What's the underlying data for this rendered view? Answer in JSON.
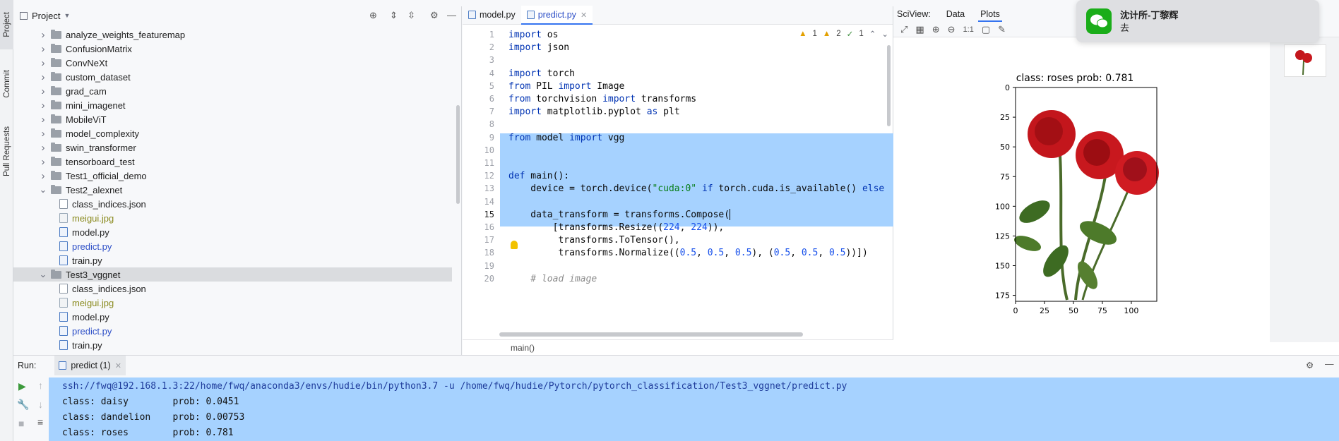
{
  "left_strip": {
    "tabs": [
      "Project",
      "Commit",
      "Pull Requests"
    ]
  },
  "project": {
    "title": "Project",
    "tree": [
      {
        "name": "analyze_weights_featuremap",
        "type": "folder",
        "state": "collapsed",
        "depth": 1,
        "color": "default"
      },
      {
        "name": "ConfusionMatrix",
        "type": "folder",
        "state": "collapsed",
        "depth": 1,
        "color": "default"
      },
      {
        "name": "ConvNeXt",
        "type": "folder",
        "state": "collapsed",
        "depth": 1,
        "color": "default"
      },
      {
        "name": "custom_dataset",
        "type": "folder",
        "state": "collapsed",
        "depth": 1,
        "color": "default"
      },
      {
        "name": "grad_cam",
        "type": "folder",
        "state": "collapsed",
        "depth": 1,
        "color": "default"
      },
      {
        "name": "mini_imagenet",
        "type": "folder",
        "state": "collapsed",
        "depth": 1,
        "color": "default"
      },
      {
        "name": "MobileViT",
        "type": "folder",
        "state": "collapsed",
        "depth": 1,
        "color": "default"
      },
      {
        "name": "model_complexity",
        "type": "folder",
        "state": "collapsed",
        "depth": 1,
        "color": "default"
      },
      {
        "name": "swin_transformer",
        "type": "folder",
        "state": "collapsed",
        "depth": 1,
        "color": "default"
      },
      {
        "name": "tensorboard_test",
        "type": "folder",
        "state": "collapsed",
        "depth": 1,
        "color": "default"
      },
      {
        "name": "Test1_official_demo",
        "type": "folder",
        "state": "collapsed",
        "depth": 1,
        "color": "default"
      },
      {
        "name": "Test2_alexnet",
        "type": "folder",
        "state": "expanded",
        "depth": 1,
        "color": "default"
      },
      {
        "name": "class_indices.json",
        "type": "json",
        "depth": 2,
        "color": "default"
      },
      {
        "name": "meigui.jpg",
        "type": "img",
        "depth": 2,
        "color": "olive"
      },
      {
        "name": "model.py",
        "type": "py",
        "depth": 2,
        "color": "default"
      },
      {
        "name": "predict.py",
        "type": "py",
        "depth": 2,
        "color": "blue"
      },
      {
        "name": "train.py",
        "type": "py",
        "depth": 2,
        "color": "default"
      },
      {
        "name": "Test3_vggnet",
        "type": "folder",
        "state": "expanded",
        "depth": 1,
        "color": "default",
        "selected": true
      },
      {
        "name": "class_indices.json",
        "type": "json",
        "depth": 2,
        "color": "default"
      },
      {
        "name": "meigui.jpg",
        "type": "img",
        "depth": 2,
        "color": "olive"
      },
      {
        "name": "model.py",
        "type": "py",
        "depth": 2,
        "color": "default"
      },
      {
        "name": "predict.py",
        "type": "py",
        "depth": 2,
        "color": "blue"
      },
      {
        "name": "train.py",
        "type": "py",
        "depth": 2,
        "color": "default"
      }
    ]
  },
  "editor": {
    "tabs": [
      {
        "label": "model.py",
        "active": false
      },
      {
        "label": "predict.py",
        "active": true
      }
    ],
    "inspections": {
      "warnings_a": "1",
      "warnings_b": "2",
      "ok": "1"
    },
    "lines": [
      {
        "n": "1",
        "code": "import os"
      },
      {
        "n": "2",
        "code": "import json"
      },
      {
        "n": "3",
        "code": ""
      },
      {
        "n": "4",
        "code": "import torch"
      },
      {
        "n": "5",
        "code": "from PIL import Image"
      },
      {
        "n": "6",
        "code": "from torchvision import transforms"
      },
      {
        "n": "7",
        "code": "import matplotlib.pyplot as plt"
      },
      {
        "n": "8",
        "code": ""
      },
      {
        "n": "9",
        "code": "from model import vgg"
      },
      {
        "n": "10",
        "code": ""
      },
      {
        "n": "11",
        "code": ""
      },
      {
        "n": "12",
        "code": "def main():"
      },
      {
        "n": "13",
        "code": "    device = torch.device(\"cuda:0\" if torch.cuda.is_available() else"
      },
      {
        "n": "14",
        "code": ""
      },
      {
        "n": "15",
        "code": "    data_transform = transforms.Compose("
      },
      {
        "n": "16",
        "code": "        [transforms.Resize((224, 224)),"
      },
      {
        "n": "17",
        "code": "         transforms.ToTensor(),"
      },
      {
        "n": "18",
        "code": "         transforms.Normalize((0.5, 0.5, 0.5), (0.5, 0.5, 0.5))])"
      },
      {
        "n": "19",
        "code": ""
      },
      {
        "n": "20",
        "code": "    # load image"
      }
    ],
    "breadcrumb": "main()"
  },
  "sciview": {
    "title": "SciView:",
    "tabs": [
      "Data",
      "Plots"
    ],
    "active_tab": "Plots",
    "zoom_label": "1:1",
    "plot": {
      "title": "class: roses   prob: 0.781",
      "y_ticks": [
        "0",
        "25",
        "50",
        "75",
        "100",
        "125",
        "150",
        "175"
      ],
      "x_ticks": [
        "0",
        "25",
        "50",
        "75",
        "100"
      ]
    }
  },
  "notification": {
    "title": "沈计所-丁黎辉",
    "body": "去",
    "accent": "#1aad19"
  },
  "run": {
    "label": "Run:",
    "tab": "predict (1)",
    "output": [
      "ssh://fwq@192.168.1.3:22/home/fwq/anaconda3/envs/hudie/bin/python3.7 -u /home/fwq/hudie/Pytorch/pytorch_classification/Test3_vggnet/predict.py",
      "class: daisy        prob: 0.0451",
      "class: dandelion    prob: 0.00753",
      "class: roses        prob: 0.781"
    ]
  },
  "colors": {
    "selection": "#a6d2ff",
    "keyword": "#0033b3",
    "string": "#067d17",
    "number": "#1750eb",
    "accent": "#3574f0"
  }
}
